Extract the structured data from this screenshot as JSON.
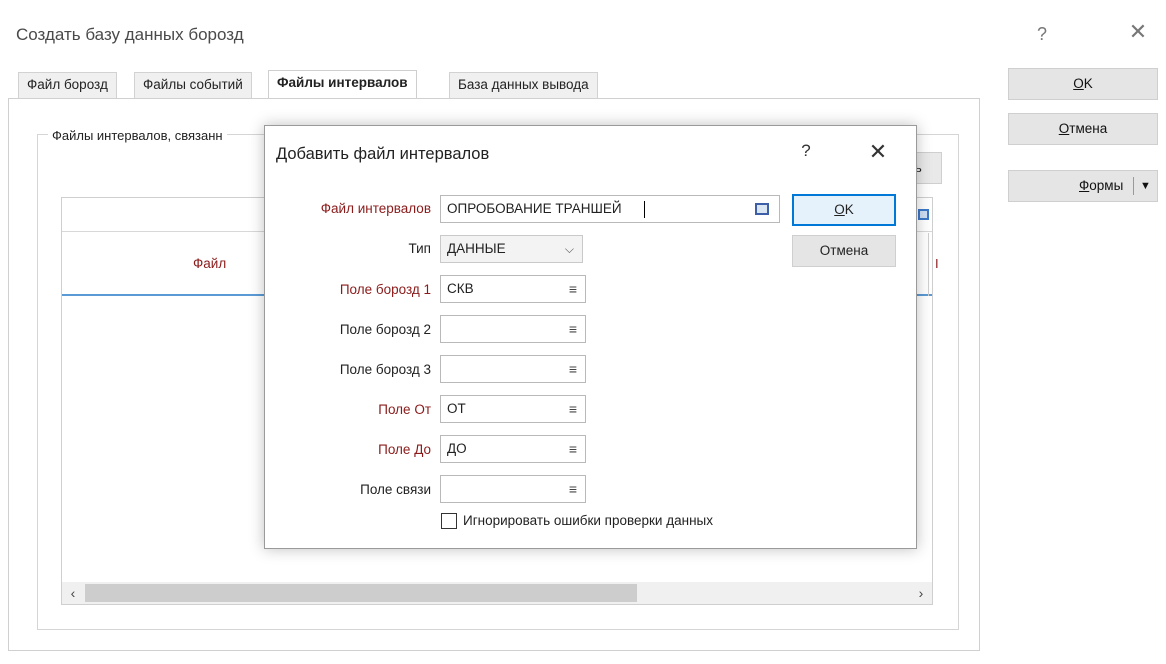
{
  "window": {
    "title": "Создать базу данных борозд",
    "help_glyph": "?",
    "close_glyph": "✕"
  },
  "tabs": [
    {
      "label": "Файл борозд",
      "active": false
    },
    {
      "label": "Файлы событий",
      "active": false
    },
    {
      "label": "Файлы интервалов",
      "active": true
    },
    {
      "label": "База данных вывода",
      "active": false
    }
  ],
  "group": {
    "title": "Файлы интервалов, связанн"
  },
  "background_button_partial": "ь",
  "grid": {
    "column_file": "Файл",
    "column_right_mark": "I",
    "scroll_left": "‹",
    "scroll_right": "›"
  },
  "side_buttons": {
    "ok_mnemonic": "O",
    "ok_rest": "K",
    "cancel_mnemonic": "О",
    "cancel_rest": "тмена",
    "forms_mnemonic": "Ф",
    "forms_rest": "ормы",
    "forms_arrow": "▼"
  },
  "dialog": {
    "title": "Добавить файл интервалов",
    "help_glyph": "?",
    "close_glyph": "✕",
    "ok_mnemonic": "O",
    "ok_rest": "K",
    "cancel_label": "Отмена",
    "fields": {
      "file_label": "Файл интервалов",
      "file_value": "ОПРОБОВАНИЕ ТРАНШЕЙ",
      "type_label": "Тип",
      "type_value": "ДАННЫЕ",
      "hole1_label": "Поле борозд 1",
      "hole1_value": "СКВ",
      "hole2_label": "Поле борозд 2",
      "hole2_value": "",
      "hole3_label": "Поле борозд 3",
      "hole3_value": "",
      "from_label": "Поле От",
      "from_value": "ОТ",
      "to_label": "Поле До",
      "to_value": "ДО",
      "link_label": "Поле связи",
      "link_value": ""
    },
    "menu_glyph": "≡",
    "chevron_glyph": "⌵",
    "ignore_checkbox": {
      "label": "Игнорировать ошибки проверки данных",
      "checked": false
    }
  },
  "colors": {
    "required_label": "#8b1a1a",
    "accent": "#0078d7",
    "header_underline": "#5b9bd5"
  }
}
